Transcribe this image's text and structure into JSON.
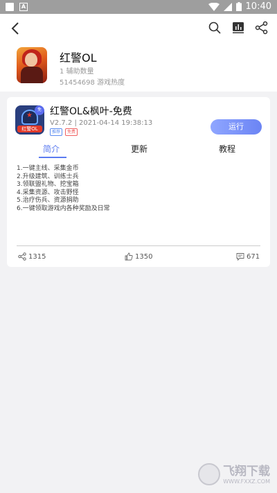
{
  "status_bar": {
    "time": "10:40",
    "colors": {
      "background": "#9e9e9e",
      "text": "#ffffff"
    }
  },
  "top_bar": {
    "icons": [
      "back-arrow-icon",
      "search-icon",
      "chart-icon",
      "share-icon"
    ]
  },
  "game": {
    "title": "红警OL",
    "assist_count": "1 辅助数量",
    "heat": "51454698 游戏热度"
  },
  "script": {
    "title": "红警OL&枫叶-免费",
    "meta": "V2.7.2 | 2021-04-14 19:38:13",
    "tags": [
      "推荐",
      "免费"
    ],
    "icon_banner": "红警OL",
    "icon_badge": "免",
    "run_label": "运行",
    "tabs": [
      "简介",
      "更新",
      "教程"
    ],
    "active_tab": "简介",
    "description": [
      "1.一键主线、采集金币",
      "2.升级建筑、训练士兵",
      "3.领联盟礼物、挖宝箱",
      "4.采集资源、攻击野怪",
      "5.治疗伤兵、资源捐助",
      "6.一键领取游戏内各种奖励及日常"
    ],
    "stats": {
      "shares": "1315",
      "likes": "1350",
      "comments": "671"
    }
  },
  "watermark": {
    "text": "飞翔下载",
    "sub": "WWW.FXXZ.COM"
  },
  "colors": {
    "accent": "#5b7bf0",
    "page_bg": "#f2f2f4",
    "tag_blue": "#5b8cf0",
    "tag_red": "#f06060"
  }
}
